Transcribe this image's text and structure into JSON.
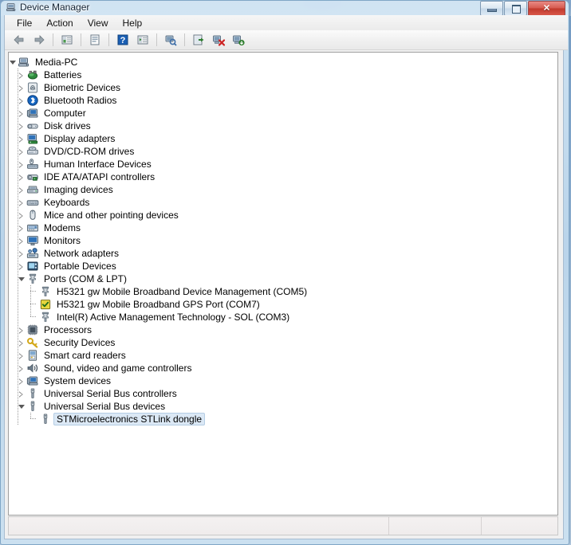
{
  "window": {
    "title": "Device Manager",
    "title_icon": "device-manager-icon",
    "controls": {
      "minimize": "minimize-button",
      "maximize": "maximize-button",
      "close_label": "✕"
    }
  },
  "menubar": {
    "items": [
      {
        "label": "File",
        "name": "menu-file"
      },
      {
        "label": "Action",
        "name": "menu-action"
      },
      {
        "label": "View",
        "name": "menu-view"
      },
      {
        "label": "Help",
        "name": "menu-help"
      }
    ]
  },
  "toolbar": {
    "buttons": [
      {
        "name": "back-button",
        "icon": "back-arrow-icon"
      },
      {
        "name": "forward-button",
        "icon": "forward-arrow-icon"
      },
      {
        "name": "separator-1",
        "icon": "separator"
      },
      {
        "name": "show-hide-console-tree-button",
        "icon": "console-tree-icon"
      },
      {
        "name": "separator-2",
        "icon": "separator"
      },
      {
        "name": "properties-button",
        "icon": "properties-icon"
      },
      {
        "name": "separator-3",
        "icon": "separator"
      },
      {
        "name": "help-button",
        "icon": "help-question-icon"
      },
      {
        "name": "show-hide-action-pane-button",
        "icon": "action-pane-icon"
      },
      {
        "name": "separator-4",
        "icon": "separator"
      },
      {
        "name": "scan-for-hardware-changes-button",
        "icon": "scan-hardware-icon"
      },
      {
        "name": "separator-5",
        "icon": "separator"
      },
      {
        "name": "update-driver-button",
        "icon": "update-driver-icon"
      },
      {
        "name": "disable-device-button",
        "icon": "disable-device-icon"
      },
      {
        "name": "enable-device-button",
        "icon": "enable-device-icon"
      }
    ]
  },
  "tree": {
    "root": {
      "label": "Media-PC",
      "icon": "computer-icon",
      "expanded": true
    },
    "nodes": [
      {
        "label": "Batteries",
        "icon": "battery-icon",
        "level": 1,
        "expanded": false
      },
      {
        "label": "Biometric Devices",
        "icon": "fingerprint-icon",
        "level": 1,
        "expanded": false
      },
      {
        "label": "Bluetooth Radios",
        "icon": "bluetooth-icon",
        "level": 1,
        "expanded": false
      },
      {
        "label": "Computer",
        "icon": "computer-node-icon",
        "level": 1,
        "expanded": false
      },
      {
        "label": "Disk drives",
        "icon": "disk-drive-icon",
        "level": 1,
        "expanded": false
      },
      {
        "label": "Display adapters",
        "icon": "display-adapter-icon",
        "level": 1,
        "expanded": false
      },
      {
        "label": "DVD/CD-ROM drives",
        "icon": "dvd-drive-icon",
        "level": 1,
        "expanded": false
      },
      {
        "label": "Human Interface Devices",
        "icon": "hid-icon",
        "level": 1,
        "expanded": false
      },
      {
        "label": "IDE ATA/ATAPI controllers",
        "icon": "ide-controller-icon",
        "level": 1,
        "expanded": false
      },
      {
        "label": "Imaging devices",
        "icon": "imaging-device-icon",
        "level": 1,
        "expanded": false
      },
      {
        "label": "Keyboards",
        "icon": "keyboard-icon",
        "level": 1,
        "expanded": false
      },
      {
        "label": "Mice and other pointing devices",
        "icon": "mouse-icon",
        "level": 1,
        "expanded": false
      },
      {
        "label": "Modems",
        "icon": "modem-icon",
        "level": 1,
        "expanded": false
      },
      {
        "label": "Monitors",
        "icon": "monitor-icon",
        "level": 1,
        "expanded": false
      },
      {
        "label": "Network adapters",
        "icon": "network-adapter-icon",
        "level": 1,
        "expanded": false
      },
      {
        "label": "Portable Devices",
        "icon": "portable-device-icon",
        "level": 1,
        "expanded": false
      },
      {
        "label": "Ports (COM & LPT)",
        "icon": "port-icon",
        "level": 1,
        "expanded": true
      },
      {
        "label": "H5321 gw Mobile Broadband Device Management (COM5)",
        "icon": "port-icon",
        "level": 2,
        "expanded": null
      },
      {
        "label": "H5321 gw Mobile Broadband GPS Port (COM7)",
        "icon": "port-gps-icon",
        "level": 2,
        "expanded": null
      },
      {
        "label": "Intel(R) Active Management Technology - SOL (COM3)",
        "icon": "port-icon",
        "level": 2,
        "expanded": null
      },
      {
        "label": "Processors",
        "icon": "processor-icon",
        "level": 1,
        "expanded": false
      },
      {
        "label": "Security Devices",
        "icon": "security-key-icon",
        "level": 1,
        "expanded": false
      },
      {
        "label": "Smart card readers",
        "icon": "smart-card-reader-icon",
        "level": 1,
        "expanded": false
      },
      {
        "label": "Sound, video and game controllers",
        "icon": "sound-controller-icon",
        "level": 1,
        "expanded": false
      },
      {
        "label": "System devices",
        "icon": "system-device-icon",
        "level": 1,
        "expanded": false
      },
      {
        "label": "Universal Serial Bus controllers",
        "icon": "usb-icon",
        "level": 1,
        "expanded": false
      },
      {
        "label": "Universal Serial Bus devices",
        "icon": "usb-icon",
        "level": 1,
        "expanded": true
      },
      {
        "label": "STMicroelectronics STLink dongle",
        "icon": "usb-device-icon",
        "level": 2,
        "expanded": null,
        "selected": true
      }
    ]
  },
  "statusbar": {
    "pane1": "",
    "pane2": "",
    "pane3": ""
  },
  "colors": {
    "selection_fill": "#dbe8f5",
    "selection_border": "#b4cde4",
    "close_button": "#c0392c",
    "frame": "#7fa6c6"
  }
}
